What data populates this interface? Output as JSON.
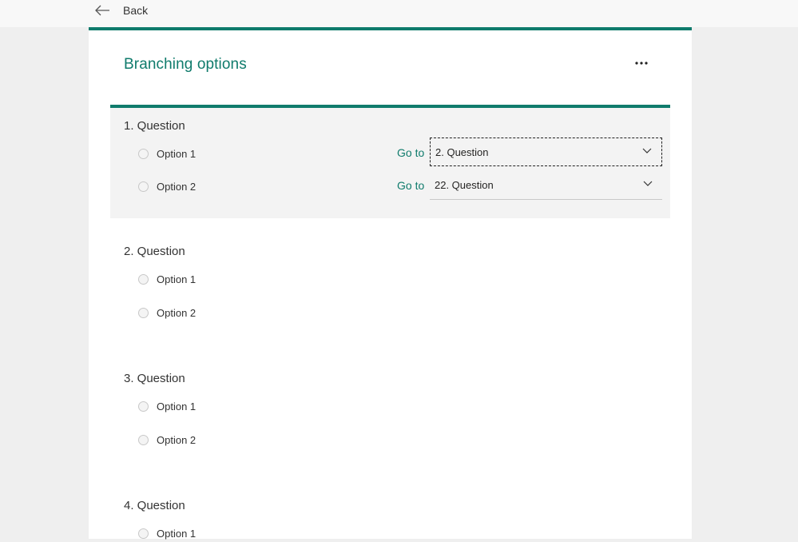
{
  "topbar": {
    "back_label": "Back"
  },
  "form": {
    "title": "Branching options"
  },
  "questions": [
    {
      "title": "1. Question",
      "options": [
        {
          "label": "Option 1",
          "goto_label": "Go to",
          "goto_value": "2. Question"
        },
        {
          "label": "Option 2",
          "goto_label": "Go to",
          "goto_value": "22. Question"
        }
      ]
    },
    {
      "title": "2. Question",
      "options": [
        {
          "label": "Option 1"
        },
        {
          "label": "Option 2"
        }
      ]
    },
    {
      "title": "3. Question",
      "options": [
        {
          "label": "Option 1"
        },
        {
          "label": "Option 2"
        }
      ]
    },
    {
      "title": "4. Question",
      "options": [
        {
          "label": "Option 1"
        }
      ]
    }
  ],
  "colors": {
    "accent": "#0f7b6c",
    "page_bg": "#efefef",
    "active_bg": "#f3f3f3"
  },
  "icons": {
    "back": "back-arrow-icon",
    "more": "more-icon",
    "chevron": "chevron-down-icon"
  }
}
